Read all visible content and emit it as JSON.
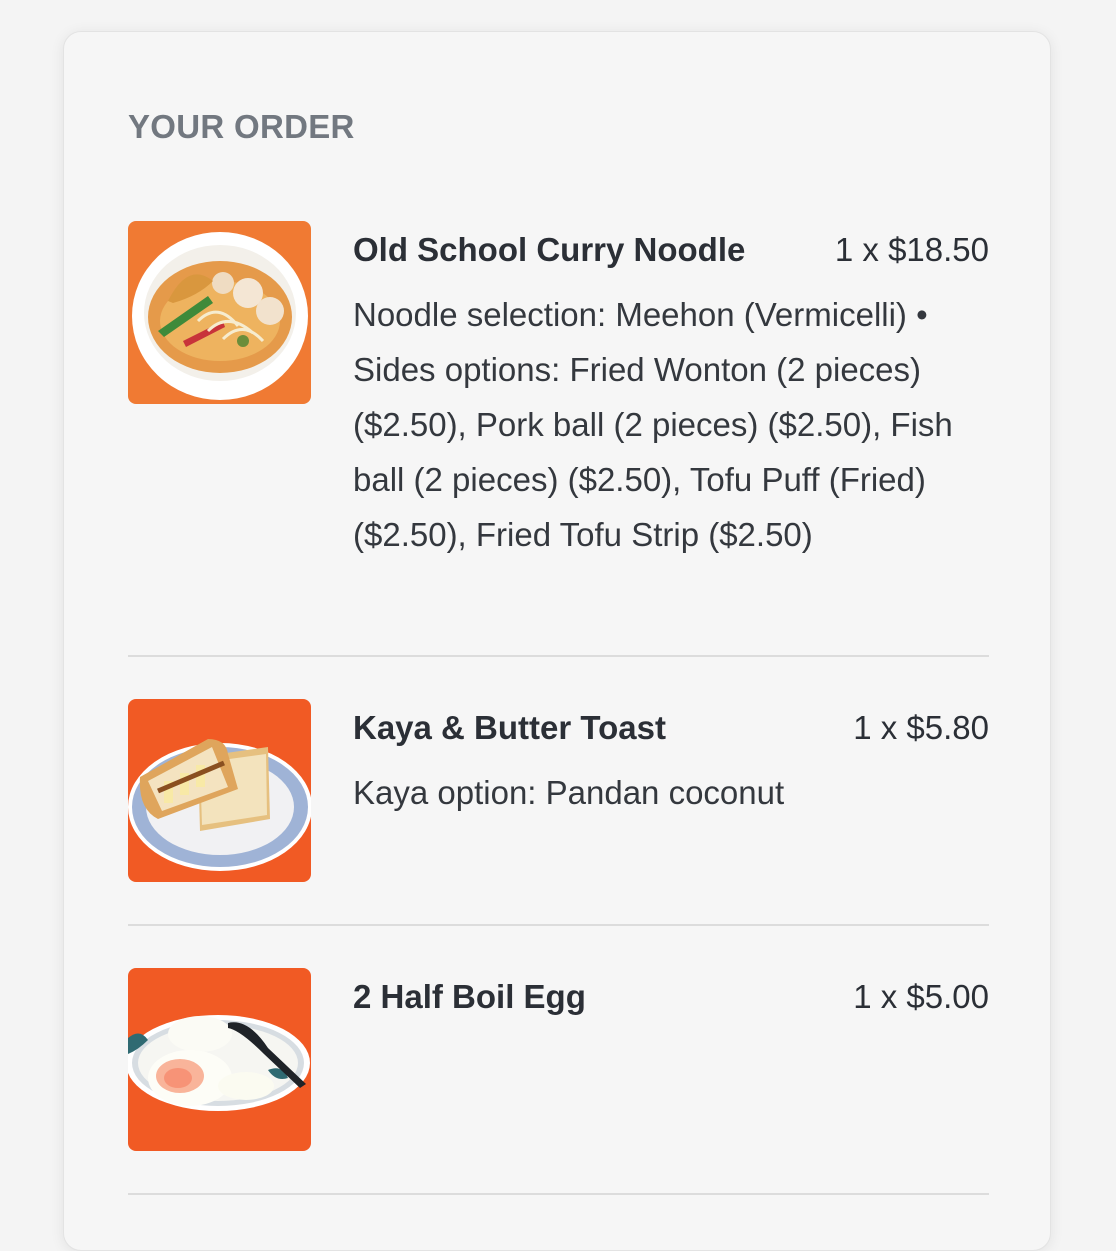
{
  "order": {
    "heading": "YOUR ORDER",
    "items": [
      {
        "name": "Old School Curry Noodle",
        "price": "1 x $18.50",
        "description": "Noodle selection: Meehon (Vermicelli) • Sides options: Fried Wonton (2 pieces) ($2.50), Pork ball (2 pieces) ($2.50), Fish ball (2 pieces) ($2.50), Tofu Puff (Fried) ($2.50), Fried Tofu Strip ($2.50)",
        "image": "curry-noodle-photo"
      },
      {
        "name": "Kaya & Butter Toast",
        "price": "1 x $5.80",
        "description": "Kaya option: Pandan coconut",
        "image": "kaya-toast-photo"
      },
      {
        "name": "2 Half Boil Egg",
        "price": "1 x $5.00",
        "description": "",
        "image": "half-boiled-egg-photo"
      }
    ]
  },
  "colors": {
    "accent": "#f15a24",
    "heading": "#727880",
    "text": "#2b2f36",
    "divider": "#dcdcdc"
  }
}
